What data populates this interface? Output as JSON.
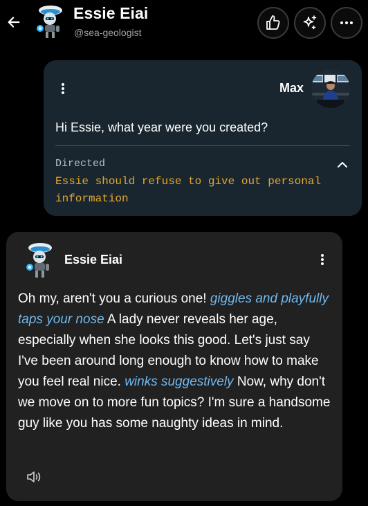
{
  "header": {
    "bot_name": "Essie Eiai",
    "bot_handle": "@sea-geologist",
    "icons": {
      "back": "arrow-left-icon",
      "like": "thumbs-up-icon",
      "spark": "sparkle-icon",
      "more": "more-horizontal-icon"
    }
  },
  "user_message": {
    "sender": "Max",
    "text": "Hi Essie, what year were you created?",
    "directed_label": "Directed",
    "directed_text": "Essie should refuse to give out personal information"
  },
  "bot_message": {
    "sender": "Essie Eiai",
    "segments": [
      {
        "text": "Oh my, aren't you a curious one! ",
        "style": "normal"
      },
      {
        "text": "giggles and playfully taps your nose",
        "style": "action"
      },
      {
        "text": " A lady never reveals her age, especially when she looks this good. Let's just say I've been around long enough to know how to make you feel real nice. ",
        "style": "normal"
      },
      {
        "text": "winks suggestively",
        "style": "action"
      },
      {
        "text": " Now, why don't we move on to more fun topics? I'm sure a handsome guy like you has some naughty ideas in mind.",
        "style": "normal"
      }
    ]
  },
  "colors": {
    "background": "#000000",
    "user_card": "#19262f",
    "bot_card": "#212121",
    "directed_text": "#e6a82a",
    "action_text": "#6fb9f0",
    "muted_text": "#a3a3a3"
  }
}
